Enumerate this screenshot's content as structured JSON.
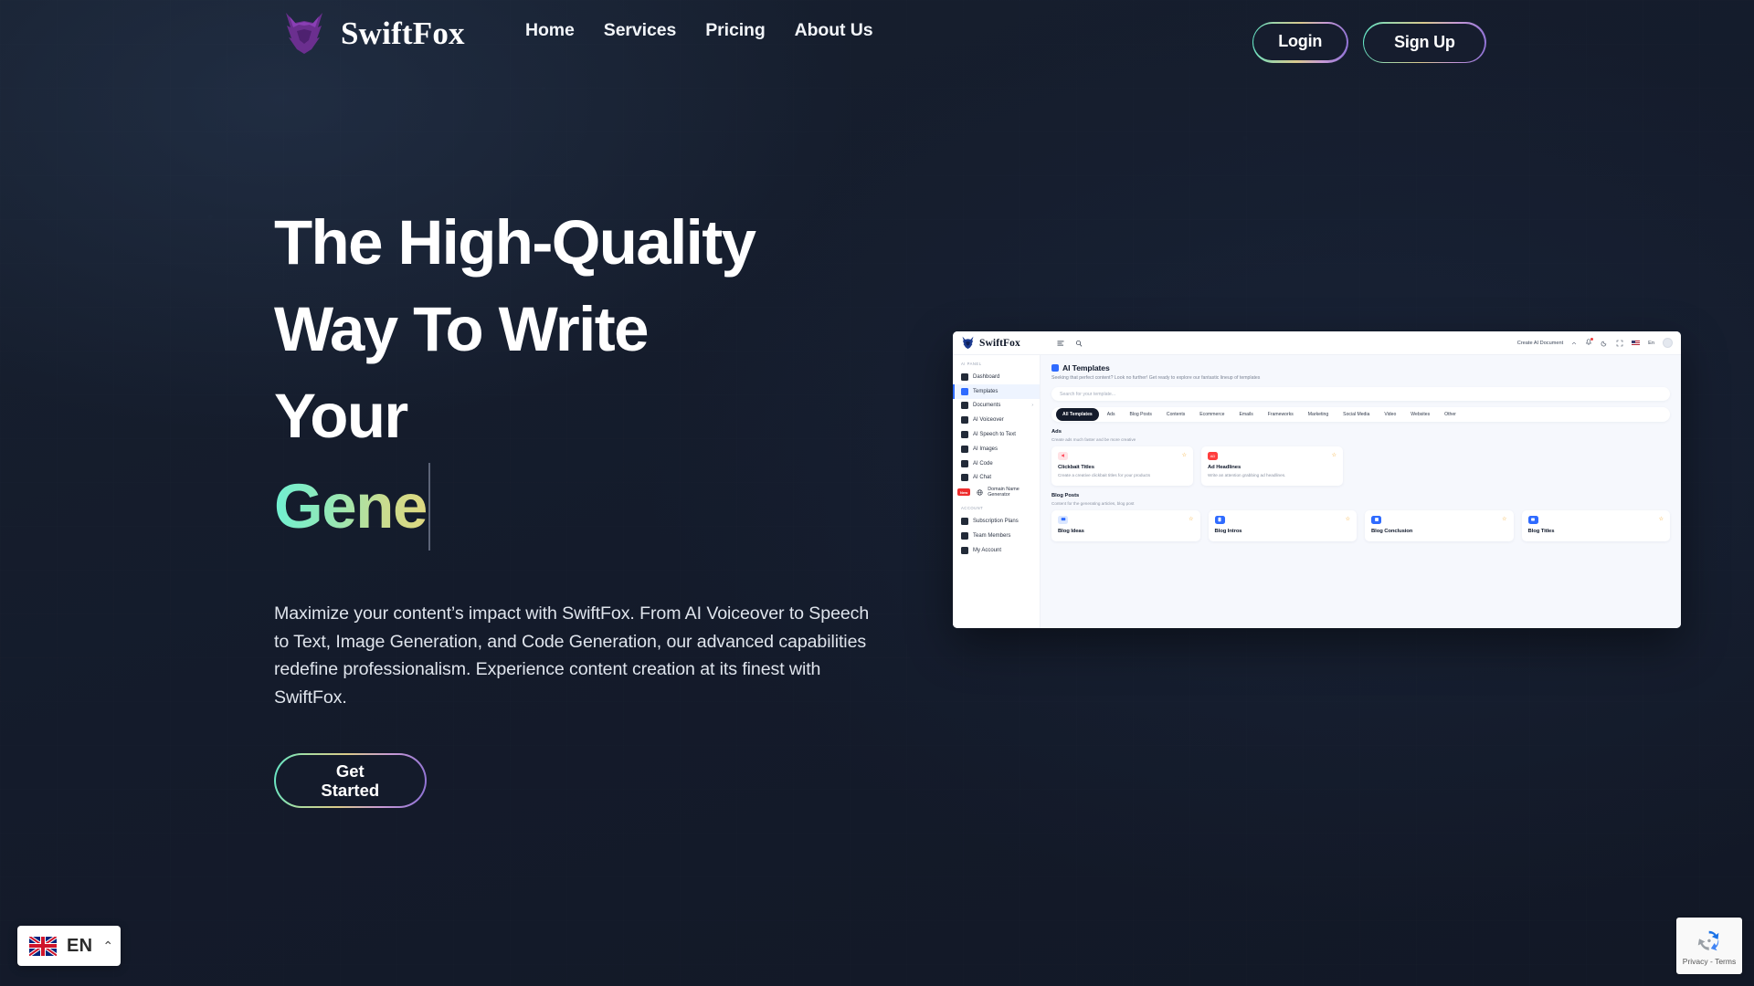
{
  "brand": {
    "name": "SwiftFox",
    "logo_icon": "fox-logo-icon"
  },
  "nav": {
    "items": [
      {
        "label": "Home"
      },
      {
        "label": "Services"
      },
      {
        "label": "Pricing"
      },
      {
        "label": "About Us"
      }
    ]
  },
  "auth": {
    "login_label": "Login",
    "signup_label": "Sign Up"
  },
  "hero": {
    "headline_line1": "The High-Quality",
    "headline_line2": "Way To Write",
    "headline_line3": "Your",
    "typed_text": "Gene",
    "paragraph": "Maximize your content’s impact with SwiftFox. From AI Voiceover to Speech to Text, Image Generation, and Code Generation, our advanced capabilities redefine professionalism. Experience content creation at its finest with SwiftFox.",
    "cta_line1": "Get",
    "cta_line2": "Started",
    "gradient_start": "#6ff0d2",
    "gradient_end": "#dfd880"
  },
  "app_preview": {
    "brand": "SwiftFox",
    "topbar": {
      "create_document_label": "Create AI Document",
      "language_label": "En",
      "icons": [
        "menu-icon",
        "search-icon",
        "chevron-up-icon",
        "bell-icon",
        "moon-icon",
        "fullscreen-icon",
        "us-flag-icon",
        "avatar"
      ]
    },
    "sidebar": {
      "section_ai_label": "AI PANEL",
      "section_account_label": "ACCOUNT",
      "ai_items": [
        {
          "label": "Dashboard",
          "icon": "dashboard-icon",
          "active": false
        },
        {
          "label": "Templates",
          "icon": "templates-icon",
          "active": true
        },
        {
          "label": "Documents",
          "icon": "documents-icon",
          "active": false,
          "chevron": "›"
        },
        {
          "label": "AI Voiceover",
          "icon": "voiceover-icon",
          "active": false
        },
        {
          "label": "AI Speech to Text",
          "icon": "speech-to-text-icon",
          "active": false
        },
        {
          "label": "AI Images",
          "icon": "images-icon",
          "active": false
        },
        {
          "label": "AI Code",
          "icon": "code-icon",
          "active": false
        },
        {
          "label": "AI Chat",
          "icon": "chat-icon",
          "active": false
        },
        {
          "label": "Domain Name Generator",
          "icon": "globe-icon",
          "active": false,
          "badge": "New"
        }
      ],
      "account_items": [
        {
          "label": "Subscription Plans",
          "icon": "subscription-icon"
        },
        {
          "label": "Team Members",
          "icon": "team-icon"
        },
        {
          "label": "My Account",
          "icon": "account-icon"
        }
      ]
    },
    "main": {
      "title": "AI Templates",
      "subtitle": "Seeking that perfect content? Look no further! Get ready to explore our fantastic lineup of templates",
      "search_placeholder": "Search for your template...",
      "tabs": [
        {
          "label": "All Templates",
          "active": true
        },
        {
          "label": "Ads",
          "active": false
        },
        {
          "label": "Blog Posts",
          "active": false
        },
        {
          "label": "Contents",
          "active": false
        },
        {
          "label": "Ecommerce",
          "active": false
        },
        {
          "label": "Emails",
          "active": false
        },
        {
          "label": "Frameworks",
          "active": false
        },
        {
          "label": "Marketing",
          "active": false
        },
        {
          "label": "Social Media",
          "active": false
        },
        {
          "label": "Video",
          "active": false
        },
        {
          "label": "Websites",
          "active": false
        },
        {
          "label": "Other",
          "active": false
        }
      ],
      "sections": [
        {
          "title": "Ads",
          "subtitle": "Create ads much faster and be more creative",
          "cards": [
            {
              "title": "Clickbait Titles",
              "desc": "Create a creative clickbait titles for your products",
              "icon": "megaphone-icon",
              "icon_style": "pink",
              "starred": true
            },
            {
              "title": "Ad Headlines",
              "desc": "Write an attention grabbing ad headlines.",
              "icon": "ad-icon",
              "icon_style": "red",
              "starred": true
            }
          ]
        },
        {
          "title": "Blog Posts",
          "subtitle": "Content for the generating articles, blog post",
          "cards": [
            {
              "title": "Blog Ideas",
              "desc": "",
              "icon": "blog-idea-icon",
              "icon_style": "bluelight",
              "starred": true
            },
            {
              "title": "Blog Intros",
              "desc": "",
              "icon": "blog-intro-icon",
              "icon_style": "blue",
              "starred": true
            },
            {
              "title": "Blog Conclusion",
              "desc": "",
              "icon": "blog-conclusion-icon",
              "icon_style": "blue",
              "starred": true
            },
            {
              "title": "Blog Titles",
              "desc": "",
              "icon": "blog-title-icon",
              "icon_style": "blue",
              "starred": true
            }
          ]
        }
      ]
    }
  },
  "language_selector": {
    "label": "EN",
    "flag": "uk-flag-icon",
    "chevron": "⌃"
  },
  "recaptcha": {
    "label": "Privacy - Terms",
    "icon": "recaptcha-icon"
  }
}
